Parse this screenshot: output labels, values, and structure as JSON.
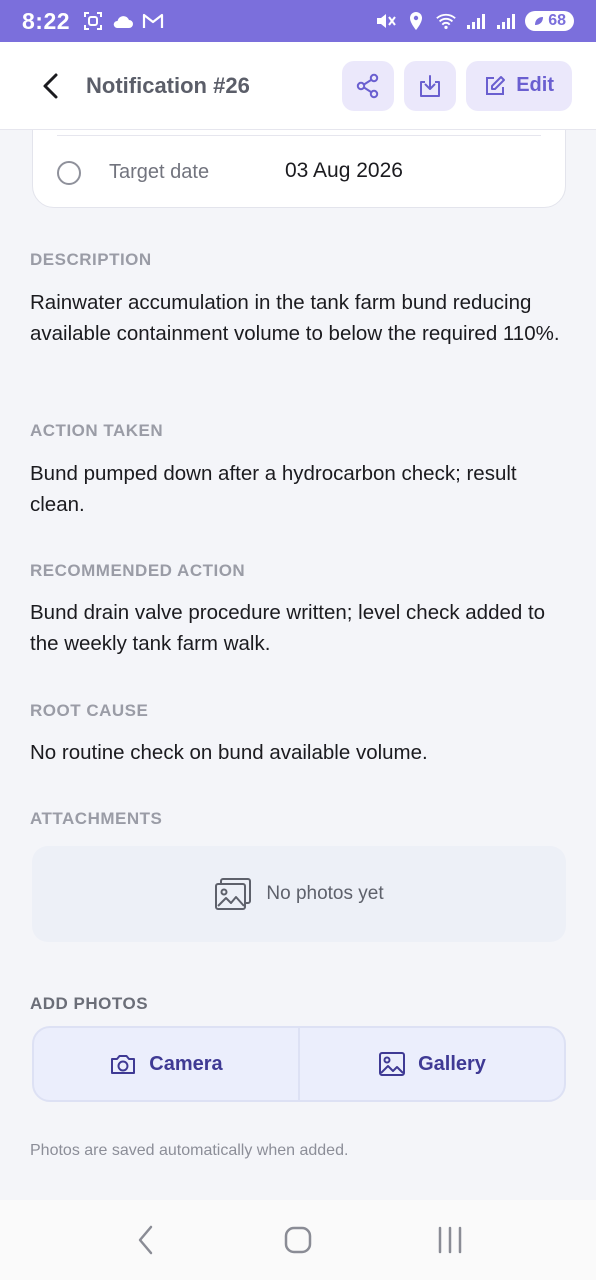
{
  "status_bar": {
    "time": "8:22",
    "battery": "68",
    "left_icons": [
      "screenshot-icon",
      "cloud-icon",
      "gmail-icon"
    ],
    "right_icons": [
      "mute-icon",
      "location-icon",
      "wifi-icon",
      "signal-icon",
      "signal-icon"
    ]
  },
  "header": {
    "title": "Notification #26",
    "edit_label": "Edit"
  },
  "card": {
    "target_label": "Target date",
    "target_value": "03 Aug 2026"
  },
  "sections": {
    "description": {
      "title": "DESCRIPTION",
      "body": "Rainwater accumulation in the tank farm bund reducing available containment volume to below the required 110%."
    },
    "action_taken": {
      "title": "ACTION TAKEN",
      "body": "Bund pumped down after a hydrocarbon check; result clean."
    },
    "recommended_action": {
      "title": "RECOMMENDED ACTION",
      "body": "Bund drain valve procedure written; level check added to the weekly tank farm walk."
    },
    "root_cause": {
      "title": "ROOT CAUSE",
      "body": "No routine check on bund available volume."
    }
  },
  "attachments": {
    "title": "ATTACHMENTS",
    "empty_text": "No photos yet"
  },
  "add_photos": {
    "title": "ADD PHOTOS",
    "camera_label": "Camera",
    "gallery_label": "Gallery",
    "hint": "Photos are saved automatically when added."
  },
  "colors": {
    "accent": "#7b6fdc",
    "button_bg": "#ebe8fb",
    "photo_button_text": "#3f3a94"
  }
}
